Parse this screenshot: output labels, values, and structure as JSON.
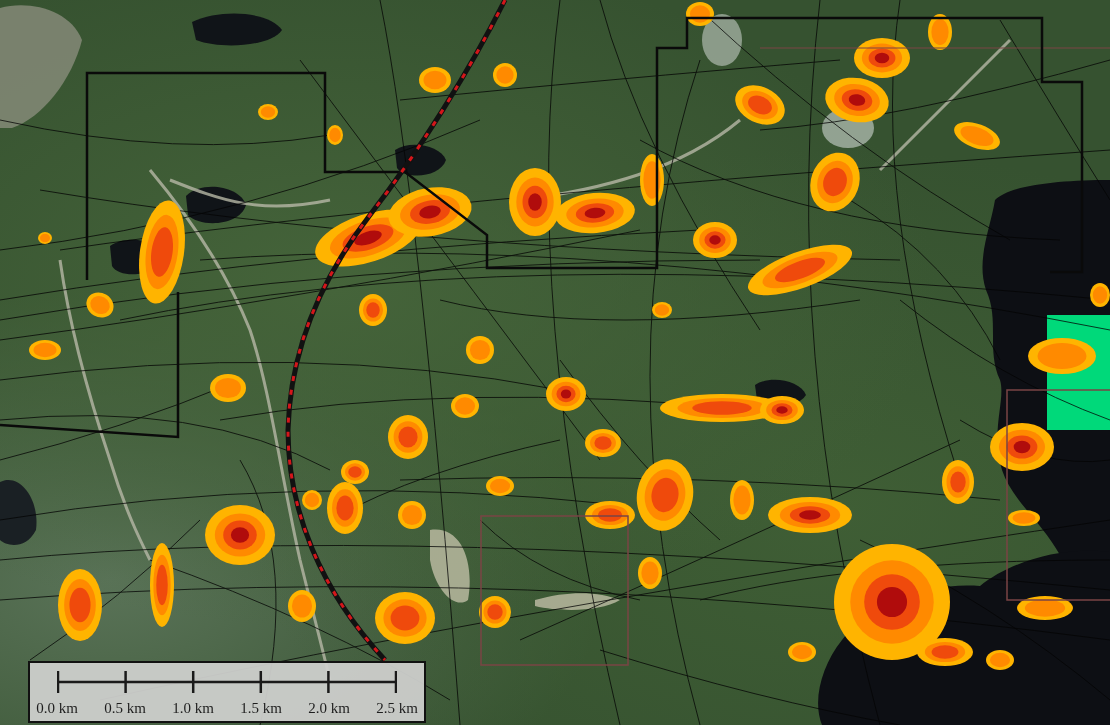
{
  "scale_bar": {
    "labels": [
      "0.0 km",
      "0.5 km",
      "1.0 km",
      "1.5 km",
      "2.0 km",
      "2.5 km"
    ]
  }
}
